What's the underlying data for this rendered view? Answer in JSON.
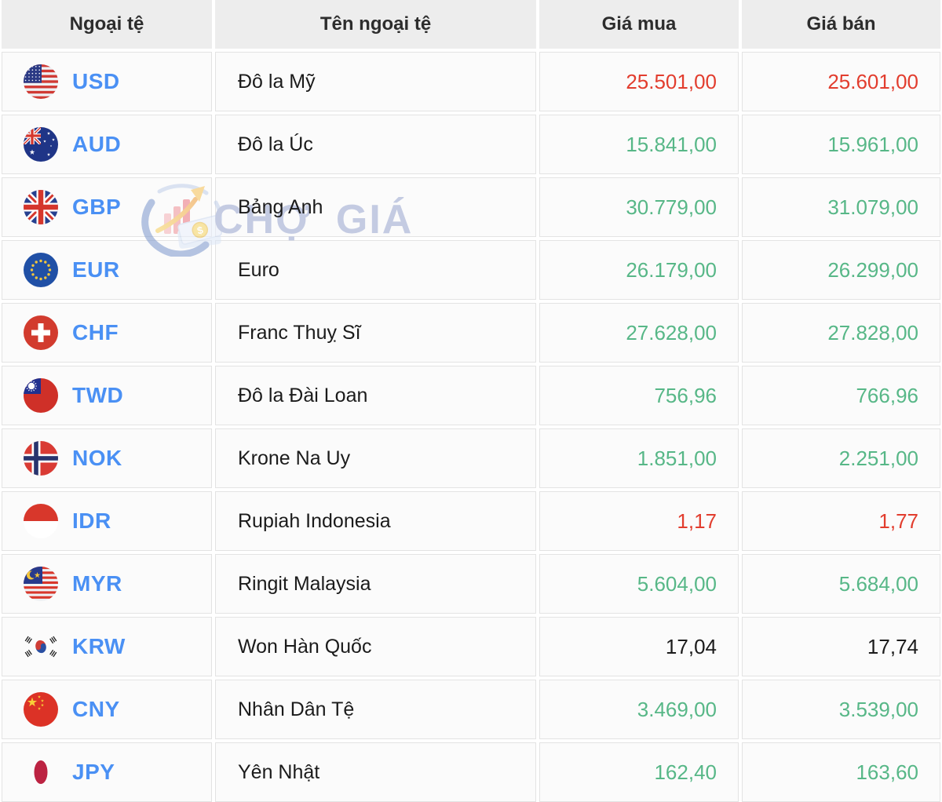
{
  "table": {
    "columns": [
      {
        "label": "Ngoại tệ"
      },
      {
        "label": "Tên ngoại tệ"
      },
      {
        "label": "Giá mua"
      },
      {
        "label": "Giá bán"
      }
    ],
    "rows": [
      {
        "code": "USD",
        "flag": "usd",
        "name": "Đô la Mỹ",
        "buy": "25.501,00",
        "sell": "25.601,00",
        "change": "down"
      },
      {
        "code": "AUD",
        "flag": "aud",
        "name": "Đô la Úc",
        "buy": "15.841,00",
        "sell": "15.961,00",
        "change": "up"
      },
      {
        "code": "GBP",
        "flag": "gbp",
        "name": "Bảng Anh",
        "buy": "30.779,00",
        "sell": "31.079,00",
        "change": "up"
      },
      {
        "code": "EUR",
        "flag": "eur",
        "name": "Euro",
        "buy": "26.179,00",
        "sell": "26.299,00",
        "change": "up"
      },
      {
        "code": "CHF",
        "flag": "chf",
        "name": "Franc Thuỵ Sĩ",
        "buy": "27.628,00",
        "sell": "27.828,00",
        "change": "up"
      },
      {
        "code": "TWD",
        "flag": "twd",
        "name": "Đô la Đài Loan",
        "buy": "756,96",
        "sell": "766,96",
        "change": "up"
      },
      {
        "code": "NOK",
        "flag": "nok",
        "name": "Krone Na Uy",
        "buy": "1.851,00",
        "sell": "2.251,00",
        "change": "up"
      },
      {
        "code": "IDR",
        "flag": "idr",
        "name": "Rupiah Indonesia",
        "buy": "1,17",
        "sell": "1,77",
        "change": "down"
      },
      {
        "code": "MYR",
        "flag": "myr",
        "name": "Ringit Malaysia",
        "buy": "5.604,00",
        "sell": "5.684,00",
        "change": "up"
      },
      {
        "code": "KRW",
        "flag": "krw",
        "name": "Won Hàn Quốc",
        "buy": "17,04",
        "sell": "17,74",
        "change": "none"
      },
      {
        "code": "CNY",
        "flag": "cny",
        "name": "Nhân Dân Tệ",
        "buy": "3.469,00",
        "sell": "3.539,00",
        "change": "up"
      },
      {
        "code": "JPY",
        "flag": "jpy",
        "name": "Yên Nhật",
        "buy": "162,40",
        "sell": "163,60",
        "change": "up"
      }
    ]
  },
  "watermark": {
    "text": "CHỢ GIÁ"
  },
  "colors": {
    "up": "#57b787",
    "down": "#e23d2e",
    "none": "#1b1b1b",
    "code_blue": "#4a90f4",
    "header_bg": "#ededed",
    "cell_bg": "#fbfbfb",
    "border": "#e3e3e3"
  }
}
